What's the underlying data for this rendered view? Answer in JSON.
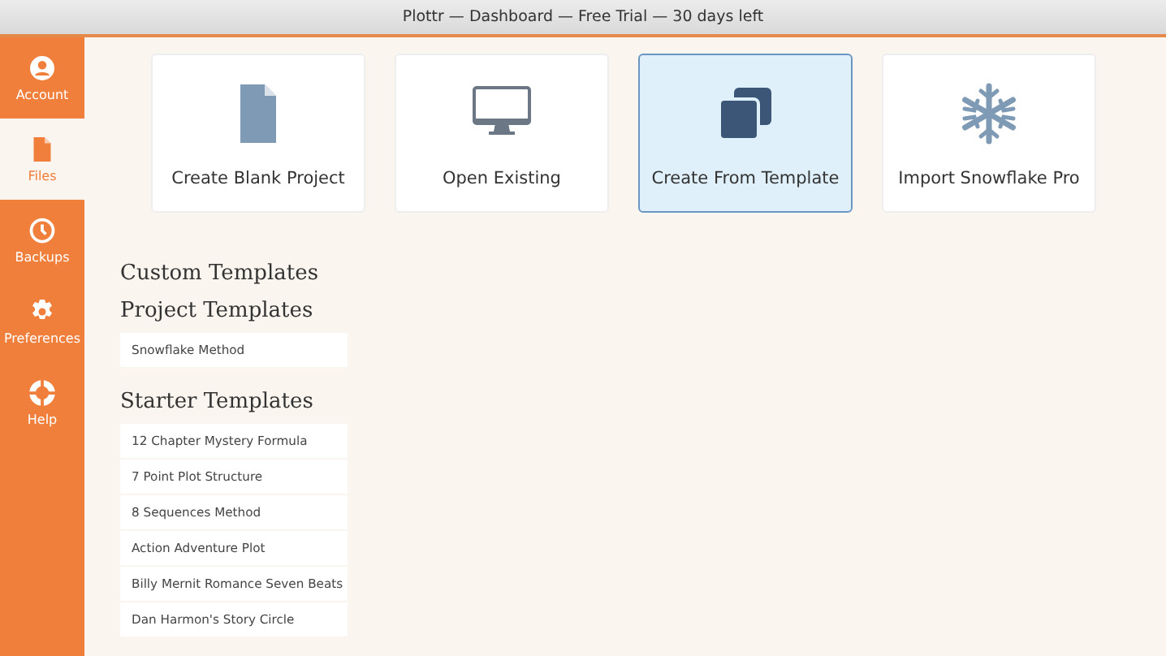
{
  "window": {
    "title": "Plottr — Dashboard — Free Trial — 30 days left"
  },
  "sidebar": {
    "items": [
      {
        "label": "Account",
        "kind": "account",
        "selected": false
      },
      {
        "label": "Files",
        "kind": "file",
        "selected": true
      },
      {
        "label": "Backups",
        "kind": "clock",
        "selected": false
      },
      {
        "label": "Preferences",
        "kind": "gear",
        "selected": false
      },
      {
        "label": "Help",
        "kind": "lifebuoy",
        "selected": false
      }
    ]
  },
  "actions": [
    {
      "label": "Create Blank Project",
      "kind": "file",
      "selected": false
    },
    {
      "label": "Open Existing",
      "kind": "monitor",
      "selected": false
    },
    {
      "label": "Create From Template",
      "kind": "copy",
      "selected": true
    },
    {
      "label": "Import Snowflake Pro",
      "kind": "snowflake",
      "selected": false
    }
  ],
  "sections": [
    {
      "title": "Custom Templates"
    },
    {
      "title": "Project Templates",
      "items": [
        "Snowflake Method"
      ]
    },
    {
      "title": "Starter Templates",
      "items": [
        "12 Chapter Mystery Formula",
        "7 Point Plot Structure",
        "8 Sequences Method",
        "Action Adventure Plot",
        "Billy Mernit Romance Seven Beats",
        "Dan Harmon's Story Circle"
      ]
    }
  ]
}
